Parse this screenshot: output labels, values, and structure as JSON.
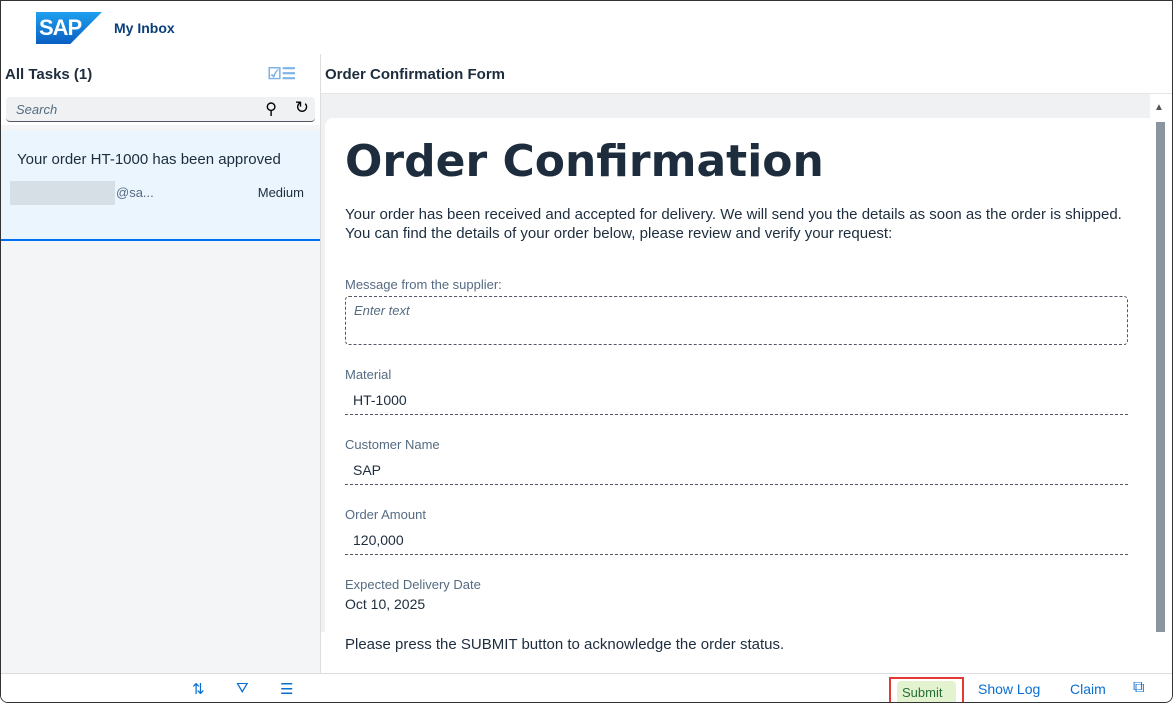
{
  "shell": {
    "logo": "SAP",
    "title": "My Inbox"
  },
  "left": {
    "title": "All Tasks (1)",
    "search_placeholder": "Search",
    "task": {
      "title": "Your order HT-1000 has been approved",
      "email": "@sa...",
      "priority": "Medium"
    }
  },
  "right": {
    "title": "Order Confirmation Form",
    "form": {
      "heading": "Order Confirmation",
      "intro": "Your order has been received and accepted for delivery. We will send you the details as soon as the order is shipped. You can find the details of your order below, please review and verify your request:",
      "message_label": "Message from the supplier:",
      "message_placeholder": "Enter text",
      "material_label": "Material",
      "material": "HT-1000",
      "customer_label": "Customer Name",
      "customer": "SAP",
      "amount_label": "Order Amount",
      "amount": "120,000",
      "date_label": "Expected Delivery Date",
      "date": "Oct 10, 2025",
      "note": "Please press the SUBMIT button to acknowledge the order status."
    },
    "footer": {
      "submit": "Submit",
      "show_log": "Show Log",
      "claim": "Claim"
    }
  }
}
